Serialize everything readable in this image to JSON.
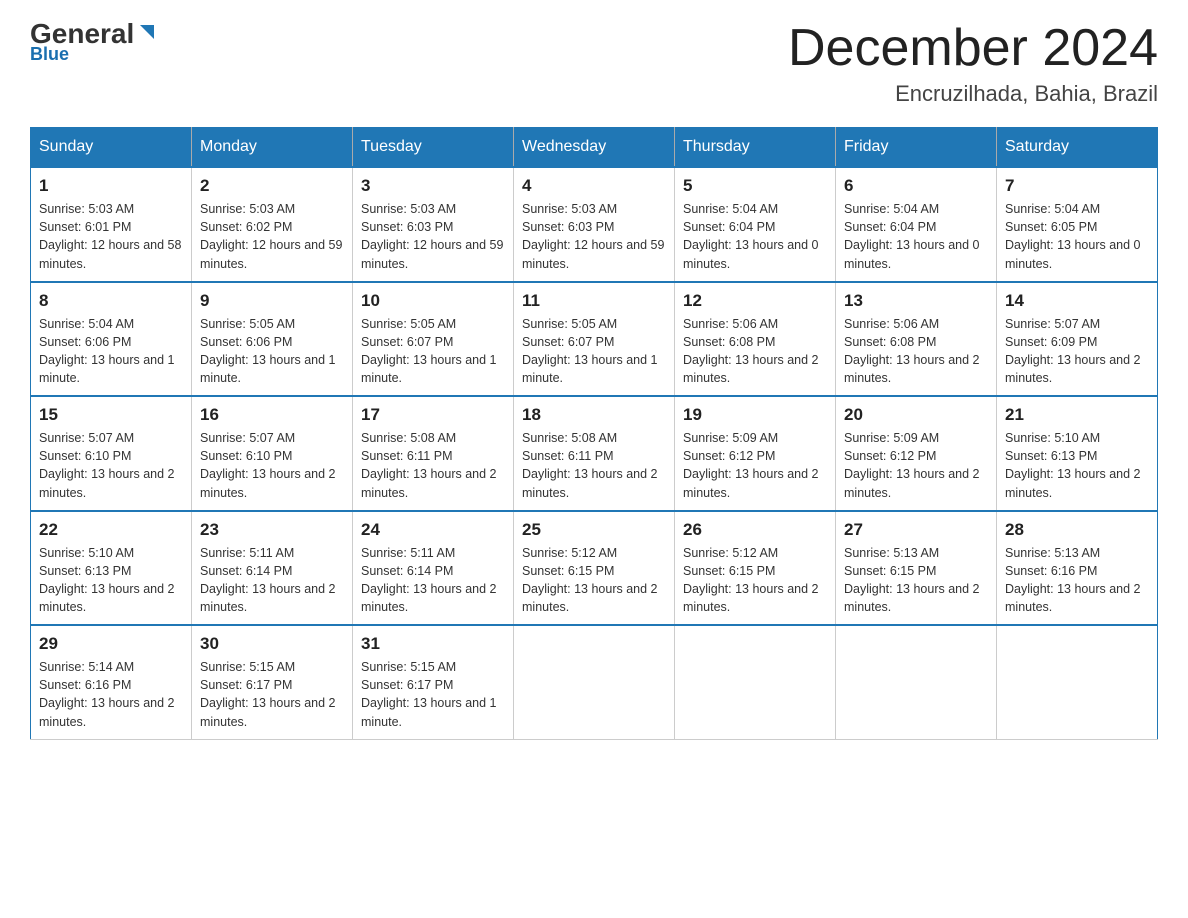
{
  "header": {
    "logo_main": "General",
    "logo_sub": "Blue",
    "month_title": "December 2024",
    "location": "Encruzilhada, Bahia, Brazil"
  },
  "days_of_week": [
    "Sunday",
    "Monday",
    "Tuesday",
    "Wednesday",
    "Thursday",
    "Friday",
    "Saturday"
  ],
  "weeks": [
    [
      {
        "day": "1",
        "sunrise": "5:03 AM",
        "sunset": "6:01 PM",
        "daylight": "12 hours and 58 minutes."
      },
      {
        "day": "2",
        "sunrise": "5:03 AM",
        "sunset": "6:02 PM",
        "daylight": "12 hours and 59 minutes."
      },
      {
        "day": "3",
        "sunrise": "5:03 AM",
        "sunset": "6:03 PM",
        "daylight": "12 hours and 59 minutes."
      },
      {
        "day": "4",
        "sunrise": "5:03 AM",
        "sunset": "6:03 PM",
        "daylight": "12 hours and 59 minutes."
      },
      {
        "day": "5",
        "sunrise": "5:04 AM",
        "sunset": "6:04 PM",
        "daylight": "13 hours and 0 minutes."
      },
      {
        "day": "6",
        "sunrise": "5:04 AM",
        "sunset": "6:04 PM",
        "daylight": "13 hours and 0 minutes."
      },
      {
        "day": "7",
        "sunrise": "5:04 AM",
        "sunset": "6:05 PM",
        "daylight": "13 hours and 0 minutes."
      }
    ],
    [
      {
        "day": "8",
        "sunrise": "5:04 AM",
        "sunset": "6:06 PM",
        "daylight": "13 hours and 1 minute."
      },
      {
        "day": "9",
        "sunrise": "5:05 AM",
        "sunset": "6:06 PM",
        "daylight": "13 hours and 1 minute."
      },
      {
        "day": "10",
        "sunrise": "5:05 AM",
        "sunset": "6:07 PM",
        "daylight": "13 hours and 1 minute."
      },
      {
        "day": "11",
        "sunrise": "5:05 AM",
        "sunset": "6:07 PM",
        "daylight": "13 hours and 1 minute."
      },
      {
        "day": "12",
        "sunrise": "5:06 AM",
        "sunset": "6:08 PM",
        "daylight": "13 hours and 2 minutes."
      },
      {
        "day": "13",
        "sunrise": "5:06 AM",
        "sunset": "6:08 PM",
        "daylight": "13 hours and 2 minutes."
      },
      {
        "day": "14",
        "sunrise": "5:07 AM",
        "sunset": "6:09 PM",
        "daylight": "13 hours and 2 minutes."
      }
    ],
    [
      {
        "day": "15",
        "sunrise": "5:07 AM",
        "sunset": "6:10 PM",
        "daylight": "13 hours and 2 minutes."
      },
      {
        "day": "16",
        "sunrise": "5:07 AM",
        "sunset": "6:10 PM",
        "daylight": "13 hours and 2 minutes."
      },
      {
        "day": "17",
        "sunrise": "5:08 AM",
        "sunset": "6:11 PM",
        "daylight": "13 hours and 2 minutes."
      },
      {
        "day": "18",
        "sunrise": "5:08 AM",
        "sunset": "6:11 PM",
        "daylight": "13 hours and 2 minutes."
      },
      {
        "day": "19",
        "sunrise": "5:09 AM",
        "sunset": "6:12 PM",
        "daylight": "13 hours and 2 minutes."
      },
      {
        "day": "20",
        "sunrise": "5:09 AM",
        "sunset": "6:12 PM",
        "daylight": "13 hours and 2 minutes."
      },
      {
        "day": "21",
        "sunrise": "5:10 AM",
        "sunset": "6:13 PM",
        "daylight": "13 hours and 2 minutes."
      }
    ],
    [
      {
        "day": "22",
        "sunrise": "5:10 AM",
        "sunset": "6:13 PM",
        "daylight": "13 hours and 2 minutes."
      },
      {
        "day": "23",
        "sunrise": "5:11 AM",
        "sunset": "6:14 PM",
        "daylight": "13 hours and 2 minutes."
      },
      {
        "day": "24",
        "sunrise": "5:11 AM",
        "sunset": "6:14 PM",
        "daylight": "13 hours and 2 minutes."
      },
      {
        "day": "25",
        "sunrise": "5:12 AM",
        "sunset": "6:15 PM",
        "daylight": "13 hours and 2 minutes."
      },
      {
        "day": "26",
        "sunrise": "5:12 AM",
        "sunset": "6:15 PM",
        "daylight": "13 hours and 2 minutes."
      },
      {
        "day": "27",
        "sunrise": "5:13 AM",
        "sunset": "6:15 PM",
        "daylight": "13 hours and 2 minutes."
      },
      {
        "day": "28",
        "sunrise": "5:13 AM",
        "sunset": "6:16 PM",
        "daylight": "13 hours and 2 minutes."
      }
    ],
    [
      {
        "day": "29",
        "sunrise": "5:14 AM",
        "sunset": "6:16 PM",
        "daylight": "13 hours and 2 minutes."
      },
      {
        "day": "30",
        "sunrise": "5:15 AM",
        "sunset": "6:17 PM",
        "daylight": "13 hours and 2 minutes."
      },
      {
        "day": "31",
        "sunrise": "5:15 AM",
        "sunset": "6:17 PM",
        "daylight": "13 hours and 1 minute."
      },
      null,
      null,
      null,
      null
    ]
  ],
  "labels": {
    "sunrise": "Sunrise:",
    "sunset": "Sunset:",
    "daylight": "Daylight:"
  }
}
